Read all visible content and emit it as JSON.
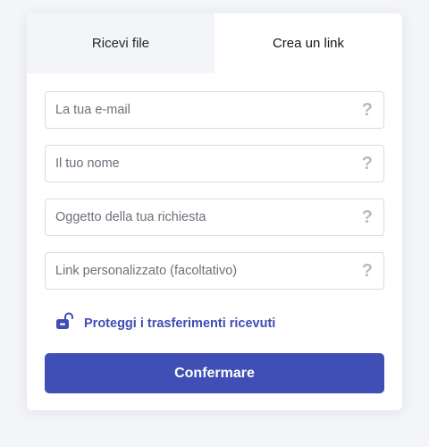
{
  "tabs": [
    {
      "label": "Ricevi file",
      "active": false
    },
    {
      "label": "Crea un link",
      "active": true
    }
  ],
  "form": {
    "email_placeholder": "La tua e-mail",
    "name_placeholder": "Il tuo nome",
    "subject_placeholder": "Oggetto della tua richiesta",
    "link_placeholder": "Link personalizzato (facoltativo)",
    "help_symbol": "?"
  },
  "protect": {
    "label": "Proteggi i trasferimenti ricevuti",
    "icon": "unlocked-padlock-icon"
  },
  "submit_label": "Confermare",
  "colors": {
    "accent": "#3f4fb6",
    "link": "#3f4db5",
    "background": "#f4f5f9"
  }
}
